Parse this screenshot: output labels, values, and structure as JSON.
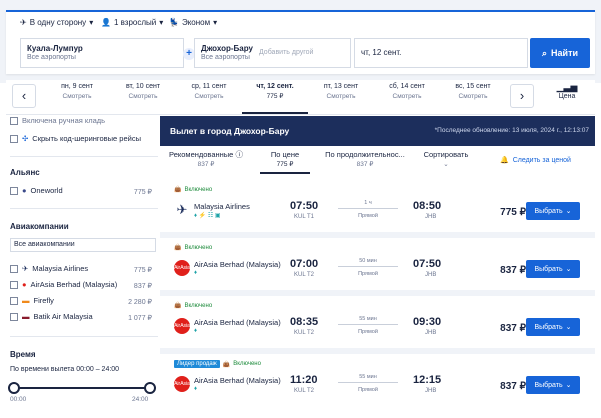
{
  "search": {
    "trip_type": "В одну сторону",
    "passengers": "1 взрослый",
    "cabin": "Эконом",
    "from_city": "Куала-Лумпур",
    "from_sub": "Все аэропорты",
    "to_city": "Джохор-Бару",
    "to_sub": "Все аэропорты",
    "add_other": "Добавить другой",
    "date": "чт, 12 сент.",
    "search_button": "Найти"
  },
  "dates": [
    {
      "day": "пн, 9 сент",
      "price": "Смотреть"
    },
    {
      "day": "вт, 10 сент",
      "price": "Смотреть"
    },
    {
      "day": "ср, 11 сент",
      "price": "Смотреть"
    },
    {
      "day": "чт, 12 сент.",
      "price": "775 ₽"
    },
    {
      "day": "пт, 13 сент",
      "price": "Смотреть"
    },
    {
      "day": "сб, 14 сент",
      "price": "Смотреть"
    },
    {
      "day": "вс, 15 сент",
      "price": "Смотреть"
    }
  ],
  "price_chart_label": "Цена",
  "sidebar": {
    "hand_bag": "Включена ручная кладь",
    "hide_codeshare": "Скрыть код-шеринговые рейсы",
    "alliance_heading": "Альянс",
    "alliance": {
      "name": "Oneworld",
      "price": "775 ₽"
    },
    "airlines_heading": "Авиакомпании",
    "all_airlines": "Все авиакомпании",
    "airlines": [
      {
        "name": "Malaysia Airlines",
        "price": "775 ₽"
      },
      {
        "name": "AirAsia Berhad (Malaysia)",
        "price": "837 ₽"
      },
      {
        "name": "Firefly",
        "price": "2 280 ₽"
      },
      {
        "name": "Batik Air Malaysia",
        "price": "1 077 ₽"
      }
    ],
    "time_heading": "Время",
    "departure_time": "По времени вылета  00:00 – 24:00",
    "slider_min": "00:00",
    "slider_max": "24:00"
  },
  "results": {
    "title": "Вылет в город Джохор-Бару",
    "updated": "*Последнее обновление: 13 июля, 2024 г., 12:13:07",
    "sort": [
      {
        "label": "Рекомендованные",
        "sub": "837 ₽"
      },
      {
        "label": "По цене",
        "sub": "775 ₽"
      },
      {
        "label": "По продолжительнос...",
        "sub": "837 ₽"
      },
      {
        "label": "Сортировать",
        "sub": ""
      }
    ],
    "track_price": "Следить за ценой",
    "flights": [
      {
        "badge": "Включено",
        "extra_badge": "",
        "airline": "Malaysia Airlines",
        "dep": "07:50",
        "dep_ap": "KUL T1",
        "dur": "1 ч",
        "type": "Прямой",
        "arr": "08:50",
        "arr_ap": "JHB",
        "price": "775 ₽",
        "select": "Выбрать"
      },
      {
        "badge": "Включено",
        "extra_badge": "",
        "airline": "AirAsia Berhad (Malaysia)",
        "dep": "07:00",
        "dep_ap": "KUL T2",
        "dur": "50 мин",
        "type": "Прямой",
        "arr": "07:50",
        "arr_ap": "JHB",
        "price": "837 ₽",
        "select": "Выбрать"
      },
      {
        "badge": "Включено",
        "extra_badge": "",
        "airline": "AirAsia Berhad (Malaysia)",
        "dep": "08:35",
        "dep_ap": "KUL T2",
        "dur": "55 мин",
        "type": "Прямой",
        "arr": "09:30",
        "arr_ap": "JHB",
        "price": "837 ₽",
        "select": "Выбрать"
      },
      {
        "badge": "Включено",
        "extra_badge": "Лидер продаж",
        "airline": "AirAsia Berhad (Malaysia)",
        "dep": "11:20",
        "dep_ap": "KUL T2",
        "dur": "55 мин",
        "type": "Прямой",
        "arr": "12:15",
        "arr_ap": "JHB",
        "price": "837 ₽",
        "select": "Выбрать"
      }
    ]
  },
  "colors": {
    "accent": "#1764d8",
    "header": "#1c2e5c",
    "included": "#1b8a3a"
  }
}
